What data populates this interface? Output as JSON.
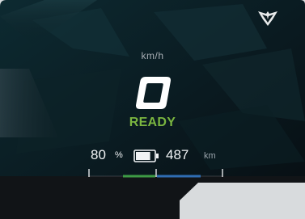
{
  "cluster": {
    "speed_unit": "km/h",
    "speed_value": "0",
    "status": "READY",
    "battery": {
      "percent": 80,
      "value": "80",
      "unit": "%"
    },
    "range": {
      "value": "487",
      "unit": "km"
    },
    "icons": {
      "brand": "cupra-logo-icon",
      "battery": "battery-icon"
    },
    "colors": {
      "ready": "#7ab540",
      "charge_bar": "#3e9b45",
      "range_bar": "#2f6db3",
      "text": "#f1f3f5"
    }
  }
}
